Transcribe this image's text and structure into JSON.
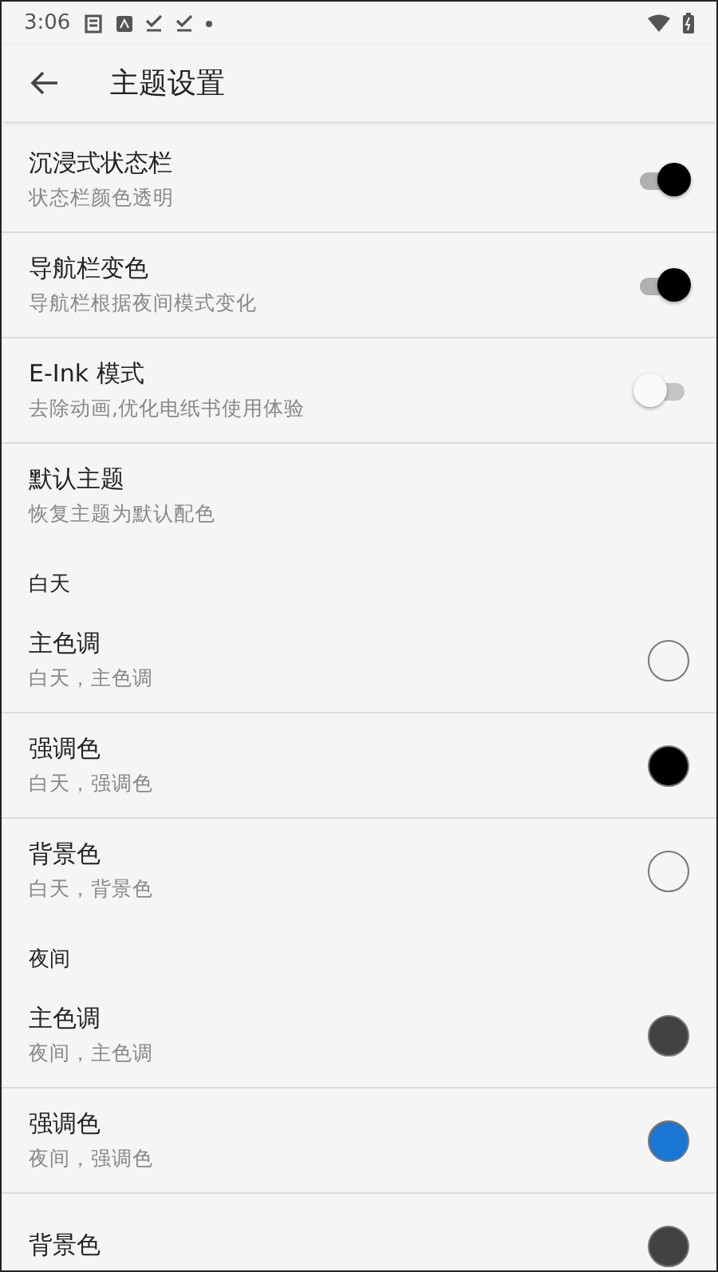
{
  "status_bar": {
    "time": "3:06"
  },
  "app_bar": {
    "title": "主题设置"
  },
  "items": [
    {
      "kind": "switch",
      "title": "沉浸式状态栏",
      "summary": "状态栏颜色透明",
      "on": true
    },
    {
      "kind": "switch",
      "title": "导航栏变色",
      "summary": "导航栏根据夜间模式变化",
      "on": true
    },
    {
      "kind": "switch",
      "title": "E-Ink 模式",
      "summary": "去除动画,优化电纸书使用体验",
      "on": false
    },
    {
      "kind": "action",
      "title": "默认主题",
      "summary": "恢复主题为默认配色"
    },
    {
      "kind": "header",
      "title": "白天"
    },
    {
      "kind": "color",
      "title": "主色调",
      "summary": "白天，主色调",
      "color": "#f5f5f5"
    },
    {
      "kind": "color",
      "title": "强调色",
      "summary": "白天，强调色",
      "color": "#000000"
    },
    {
      "kind": "color",
      "title": "背景色",
      "summary": "白天，背景色",
      "color": "#f5f5f5"
    },
    {
      "kind": "header",
      "title": "夜间"
    },
    {
      "kind": "color",
      "title": "主色调",
      "summary": "夜间，主色调",
      "color": "#424242"
    },
    {
      "kind": "color",
      "title": "强调色",
      "summary": "夜间，强调色",
      "color": "#1976d2"
    },
    {
      "kind": "color",
      "title": "背景色",
      "color": "#424242"
    }
  ]
}
